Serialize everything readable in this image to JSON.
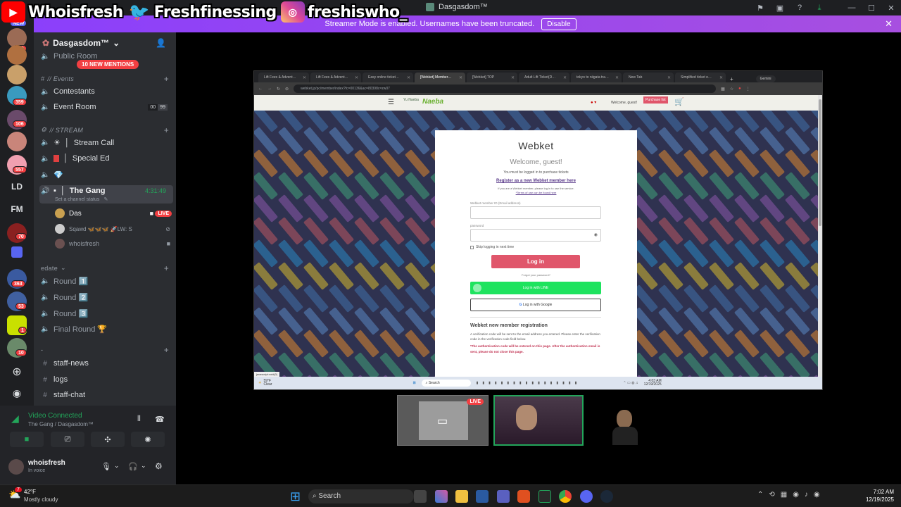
{
  "overlay": {
    "youtube": "Whoisfresh",
    "twitter": "Freshfinessing",
    "instagram": "freshiswho_"
  },
  "window": {
    "title": "Dasgasdom™",
    "controls": [
      "—",
      "☐",
      "✕"
    ]
  },
  "banner": {
    "text": "Streamer Mode is enabled. Usernames have been truncated.",
    "button": "Disable",
    "close": "✕"
  },
  "guilds": {
    "top_badge": "NEW",
    "badges": [
      "549",
      "404",
      "359",
      "106",
      "557",
      "70",
      "363",
      "53",
      "1",
      "10"
    ],
    "ld": "LD",
    "fm": "FM"
  },
  "sidebar": {
    "server_name": "Dasgasdom™",
    "public_room": "Public Room",
    "mentions": "10 NEW MENTIONS",
    "events_cat": "// Events",
    "contestants": "Contestants",
    "event_room": "Event Room",
    "event_room_count_a": "00",
    "event_room_count_b": "99",
    "stream_cat": "// STREAM",
    "stream_call": "Stream Call",
    "special_ed": "Special Ed",
    "the_gang": "The Gang",
    "gang_timer": "4:31:49",
    "channel_status": "Set a channel status",
    "users": [
      {
        "name": "Das",
        "live": "LIVE"
      },
      {
        "name": "Sqawd 🦋🦋🦋 🚀LW: S"
      },
      {
        "name": "whoisfresh"
      }
    ],
    "edate_cat": "edate",
    "rounds": [
      "Round 1️⃣",
      "Round 2️⃣",
      "Round 3️⃣",
      "Final Round 🏆"
    ],
    "misc_cat": "-",
    "text_channels": [
      "staff-news",
      "logs",
      "staff-chat"
    ]
  },
  "voice": {
    "status": "Video Connected",
    "channel": "The Gang / Dasgasdom™"
  },
  "user": {
    "name": "whoisfresh",
    "status": "In voice"
  },
  "browser": {
    "tabs": [
      "Lift Fees & Advent…",
      "Lift Fees & Advent…",
      "Easy online ticket…",
      "[Webket] Member…",
      "[Webket] TOP",
      "Adult Lift Ticket(D…",
      "tokyo to niigata tra…",
      "New Tab",
      "Simplified ticket o…"
    ],
    "gemini": "Gemini",
    "url": "webket.jp/pc/member/index?fc=00136&ac=80398c=zw07",
    "site_nav": {
      "welcome": "Welcome, guest!",
      "purchase": "Purchase list",
      "logo_a": "Yu Naeba",
      "logo_b": "Naeba"
    }
  },
  "login": {
    "brand": "Webket",
    "welcome": "Welcome, guest!",
    "must_login": "You must be logged in to purchase tickets",
    "register_link": "Register as a new Webket member here",
    "member_note": "If you are a Webket member, please log in to use the service.",
    "terms": "*Terms of use can be found here",
    "id_label": "Webket member ID (Email address)",
    "id_value": "",
    "pw_label": "password",
    "pw_value": "",
    "skip": "Skip logging in next time",
    "login_btn": "Log in",
    "forgot": "Forgot your password?",
    "line_btn": "Log in with LINE",
    "google_btn": "Log in with Google",
    "reg_title": "Webket new member registration",
    "reg_text": "A verification code will be sent to the email address you entered. Please enter the verification code in the verification code field below.",
    "reg_warning": "*The authentication code will be entered on this page. After the authentication email is sent, please do not close this page.",
    "status_url": "javascript:void(0)"
  },
  "inner_taskbar": {
    "weather": "59°F",
    "weather_sub": "Clear",
    "search": "Search",
    "time": "4:03 AM",
    "date": "12/19/2025"
  },
  "stream": {
    "live": "LIVE"
  },
  "taskbar": {
    "temp": "42°F",
    "weather": "Mostly cloudy",
    "search": "Search",
    "time": "7:02 AM",
    "date": "12/19/2025",
    "notif": "7"
  },
  "colors": {
    "banner": "#9b45e8",
    "accent_green": "#23a55a",
    "webket_red": "#e0566b",
    "line_green": "#1ee35e"
  }
}
